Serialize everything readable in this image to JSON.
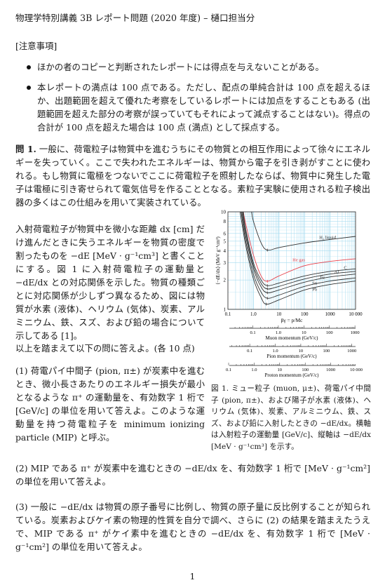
{
  "header": {
    "title": "物理学特別講義 3B レポート問題 (2020 年度) – 樋口担当分"
  },
  "notice": {
    "heading": "[注意事項]",
    "items": [
      "ほかの者のコピーと判断されたレポートには得点を与えないことがある。",
      "本レポートの満点は 100 点である。ただし、配点の単純合計は 100 点を超えるほか、出題範囲を超えて優れた考察をしているレポートには加点をすることもある (出題範囲を超えた部分の考察が誤っていてもそれによって減点することはない)。得点の合計が 100 点を超えた場合は 100 点 (満点) として採点する。"
    ]
  },
  "question1": {
    "label": "問 1.",
    "intro": "一般に、荷電粒子は物質中を進むうちにその物質との相互作用によって徐々にエネルギーを失っていく。ここで失われたエネルギーは、物質から電子を引き剥がすことに使われる。もし物質に電極をつないでここに荷電粒子を照射したならば、物質中に発生した電子は電極に引き寄せられて電気信号を作ることとなる。素粒子実験に使用される粒子検出器の多くはこの仕組みを用いて実装されている。",
    "body": "入射荷電粒子が物質中を微小な距離 dx [cm] だけ進んだときに失うエネルギーを物質の密度で割ったものを −dE [MeV · g⁻¹cm³] と書くことにする。図 1 に入射荷電粒子の運動量と −dE/dx との対応関係を示した。物質の種類ごとに対応関係が少しずつ異なるため、図には物質が水素 (液体)、ヘリウム (気体)、炭素、アルミニウム、鉄、スズ、および鉛の場合について示してある [1]。",
    "lead": "以上を踏まえて以下の問に答えよ。(各 10 点)",
    "sub1": "(1)  荷電パイ中間子 (pion, π±) が炭素中を進むとき、微小長さあたりのエネルギー損失が最小となるような π⁺ の運動量を、有効数字 1 桁で [GeV/c] の単位を用いて答えよ。このような運動量を持つ荷電粒子を minimum ionizing particle (MIP) と呼ぶ。",
    "sub2": "(2)  MIP である π⁺ が炭素中を進むときの −dE/dx を、有効数字 1 桁で [MeV · g⁻¹cm²] の単位を用いて答えよ。",
    "sub3": "(3)  一般に −dE/dx は物質の原子番号に比例し、物質の原子量に反比例することが知られている。炭素およびケイ素の物理的性質を自分で調べ、さらに (2) の結果を踏まえたうえで、MIP である π⁺ がケイ素中を進むときの −dE/dx を、有効数字 1 桁で [MeV · g⁻¹cm²] の単位を用いて答えよ。"
  },
  "figure": {
    "caption": "図 1. ミュー粒子 (muon, μ±)、荷電パイ中間子 (pion, π±)、および陽子が水素 (液体)、ヘリウム (気体)、炭素、アルミニウム、鉄、スズ、および鉛に入射したときの −dE/dx。横軸は入射粒子の運動量 [GeV/c]、縦軸は −dE/dx [MeV · g⁻¹cm³] を示す。"
  },
  "chart_data": {
    "type": "line",
    "xscale": "log",
    "yscale": "log",
    "xlabel": "βγ = p/Mc",
    "ylabel": "⟨−dE/dx⟩ (MeV g⁻¹cm²)",
    "xlim": [
      0.1,
      10000
    ],
    "ylim": [
      1,
      10
    ],
    "xticks": [
      "0.1",
      "1.0",
      "10",
      "100",
      "1000",
      "10 000"
    ],
    "yticks": [
      "1",
      "2",
      "3",
      "4",
      "5",
      "6",
      "8",
      "10"
    ],
    "grid": true,
    "colors": {
      "grid": "#a8dcf0",
      "curve": "#333333",
      "he": "#e8404a"
    },
    "series": [
      {
        "name": "H₂ liquid",
        "color": "#333333",
        "points": [
          [
            0.85,
            10
          ],
          [
            1,
            8
          ],
          [
            2,
            4.8
          ],
          [
            3.5,
            4.05
          ],
          [
            10,
            4.3
          ],
          [
            100,
            4.8
          ],
          [
            1000,
            5.2
          ],
          [
            10000,
            5.6
          ]
        ]
      },
      {
        "name": "He gas",
        "color": "#e8404a",
        "points": [
          [
            0.4,
            10
          ],
          [
            0.5,
            7.5
          ],
          [
            1,
            3.6
          ],
          [
            2,
            2.2
          ],
          [
            3.5,
            1.94
          ],
          [
            10,
            2.2
          ],
          [
            100,
            2.8
          ],
          [
            1000,
            3.1
          ],
          [
            10000,
            3.3
          ]
        ]
      },
      {
        "name": "C",
        "color": "#333333",
        "points": [
          [
            0.4,
            10
          ],
          [
            0.5,
            6.6
          ],
          [
            1,
            3.0
          ],
          [
            2,
            2.0
          ],
          [
            3.5,
            1.75
          ],
          [
            10,
            1.86
          ],
          [
            100,
            2.2
          ],
          [
            1000,
            2.45
          ],
          [
            10000,
            2.6
          ]
        ]
      },
      {
        "name": "Al",
        "color": "#333333",
        "points": [
          [
            0.38,
            10
          ],
          [
            0.5,
            6.2
          ],
          [
            1,
            2.8
          ],
          [
            2,
            1.85
          ],
          [
            3.5,
            1.62
          ],
          [
            10,
            1.72
          ],
          [
            100,
            2.05
          ],
          [
            1000,
            2.3
          ],
          [
            10000,
            2.45
          ]
        ]
      },
      {
        "name": "Fe",
        "color": "#333333",
        "points": [
          [
            0.35,
            10
          ],
          [
            0.5,
            5.6
          ],
          [
            1,
            2.6
          ],
          [
            2,
            1.7
          ],
          [
            3.5,
            1.48
          ],
          [
            10,
            1.58
          ],
          [
            100,
            1.9
          ],
          [
            1000,
            2.15
          ],
          [
            10000,
            2.3
          ]
        ]
      },
      {
        "name": "Sn",
        "color": "#333333",
        "points": [
          [
            0.33,
            10
          ],
          [
            0.5,
            5.0
          ],
          [
            1,
            2.3
          ],
          [
            2,
            1.5
          ],
          [
            3.5,
            1.3
          ],
          [
            10,
            1.4
          ],
          [
            100,
            1.72
          ],
          [
            1000,
            1.95
          ],
          [
            10000,
            2.1
          ]
        ]
      },
      {
        "name": "Pb",
        "color": "#333333",
        "points": [
          [
            0.3,
            10
          ],
          [
            0.5,
            4.5
          ],
          [
            1,
            2.05
          ],
          [
            2,
            1.32
          ],
          [
            3.2,
            1.13
          ],
          [
            10,
            1.25
          ],
          [
            100,
            1.58
          ],
          [
            1000,
            1.8
          ],
          [
            10000,
            1.95
          ]
        ]
      }
    ],
    "momentum_axes": [
      {
        "title": "Muon momentum (GeV/c)",
        "mass": 0.1057,
        "labels": [
          "0.1",
          "1.0",
          "10",
          "100",
          "1000"
        ]
      },
      {
        "title": "Pion momentum (GeV/c)",
        "mass": 0.1396,
        "labels": [
          "0.1",
          "1.0",
          "10",
          "100",
          "1000"
        ]
      },
      {
        "title": "Proton momentum (GeV/c)",
        "mass": 0.938,
        "labels": [
          "0.1",
          "1.0",
          "10",
          "100",
          "1000",
          "10 000"
        ]
      }
    ]
  },
  "footer": {
    "page_number": "1"
  }
}
